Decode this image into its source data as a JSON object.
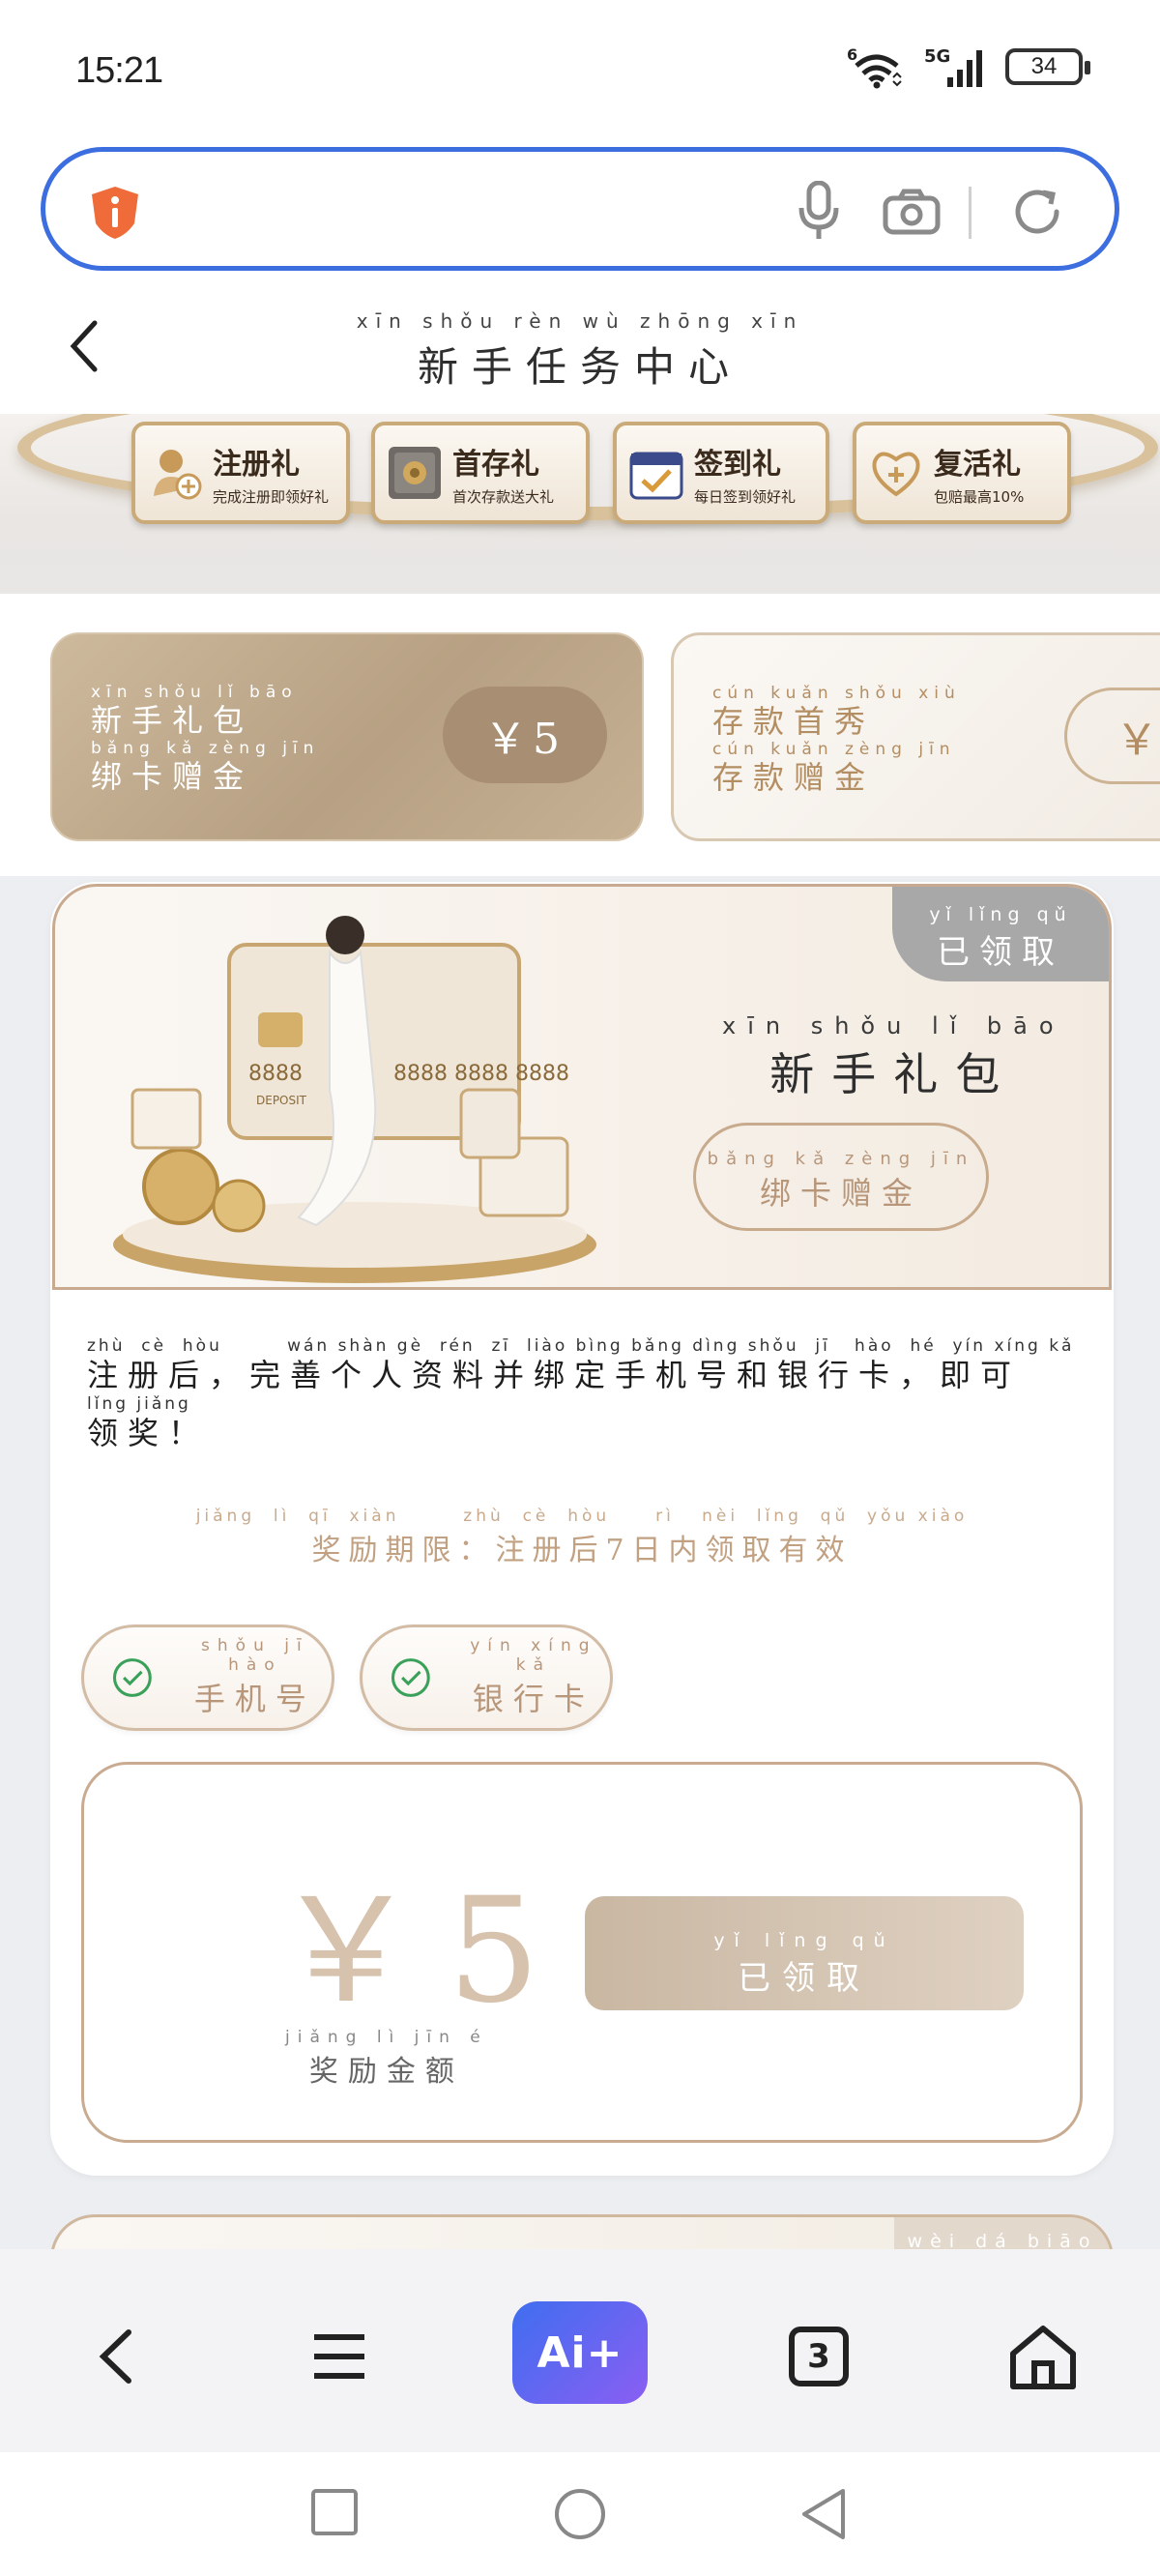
{
  "status_bar": {
    "time": "15:21",
    "wifi_label": "6",
    "network": "5G",
    "battery": "34"
  },
  "search": {
    "placeholder": ""
  },
  "header": {
    "title_pinyin": "xīn shǒu rèn wù zhōng xīn",
    "title": "新手任务中心"
  },
  "banner": {
    "items": [
      {
        "icon": "gift-hand-icon",
        "title": "注册礼",
        "subtitle": "完成注册即领好礼"
      },
      {
        "icon": "safe-box-icon",
        "title": "首存礼",
        "subtitle": "首次存款送大礼"
      },
      {
        "icon": "calendar-check-icon",
        "title": "签到礼",
        "subtitle": "每日签到领好礼"
      },
      {
        "icon": "heart-plus-icon",
        "title": "复活礼",
        "subtitle": "包赔最高10%"
      }
    ]
  },
  "cards": [
    {
      "title_pinyin": "xīn shǒu lǐ bāo",
      "title": "新手礼包",
      "sub_pinyin": "bǎng kǎ zèng jīn",
      "sub": "绑卡赠金",
      "amount": "￥5"
    },
    {
      "title_pinyin": "cún kuǎn shǒu xiù",
      "title": "存款首秀",
      "sub_pinyin": "cún kuǎn zèng jīn",
      "sub": "存款赠金",
      "amount": "￥"
    }
  ],
  "task": {
    "status_pinyin": "yǐ lǐng qǔ",
    "status": "已领取",
    "title_pinyin": "xīn shǒu lǐ bāo",
    "title": "新手礼包",
    "pill_pinyin": "bǎng kǎ zèng jīn",
    "pill": "绑卡赠金",
    "art_card_number": "8888 8888 8888",
    "art_card_left": "8888",
    "art_card_label": "DEPOSIT",
    "desc_line1_pinyin": "zhù  cè  hòu        wán shàn gè  rén  zī  liào bìng bǎng dìng shǒu  jī   hào  hé  yín xíng kǎ           jí  kě",
    "desc_line1": "注册后，完善个人资料并绑定手机号和银行卡，即可",
    "desc_line2_pinyin": "lǐng jiǎng",
    "desc_line2": "领奖！",
    "period_pinyin": "jiǎng  lì  qī  xiàn       zhù  cè  hòu     rì   nèi  lǐng  qǔ  yǒu xiào",
    "period": "奖励期限：注册后7日内领取有效",
    "verify": [
      {
        "pinyin": "shǒu jī hào",
        "label": "手机号"
      },
      {
        "pinyin": "yín xíng kǎ",
        "label": "银行卡"
      }
    ],
    "reward_amount": "￥5",
    "reward_label_pinyin": "jiǎng lì jīn é",
    "reward_label": "奖励金额",
    "claim_pinyin": "yǐ lǐng qǔ",
    "claim": "已领取"
  },
  "next_card": {
    "status_pinyin": "wèi dá biāo"
  },
  "toolbar": {
    "ai_label": "Ai+",
    "tab_count": "3"
  },
  "colors": {
    "accent_blue": "#3d6ee0",
    "gold": "#b8967a",
    "card_brown": "#b7a083",
    "status_grey": "#a8a8a8",
    "check_green": "#3aa15a"
  }
}
